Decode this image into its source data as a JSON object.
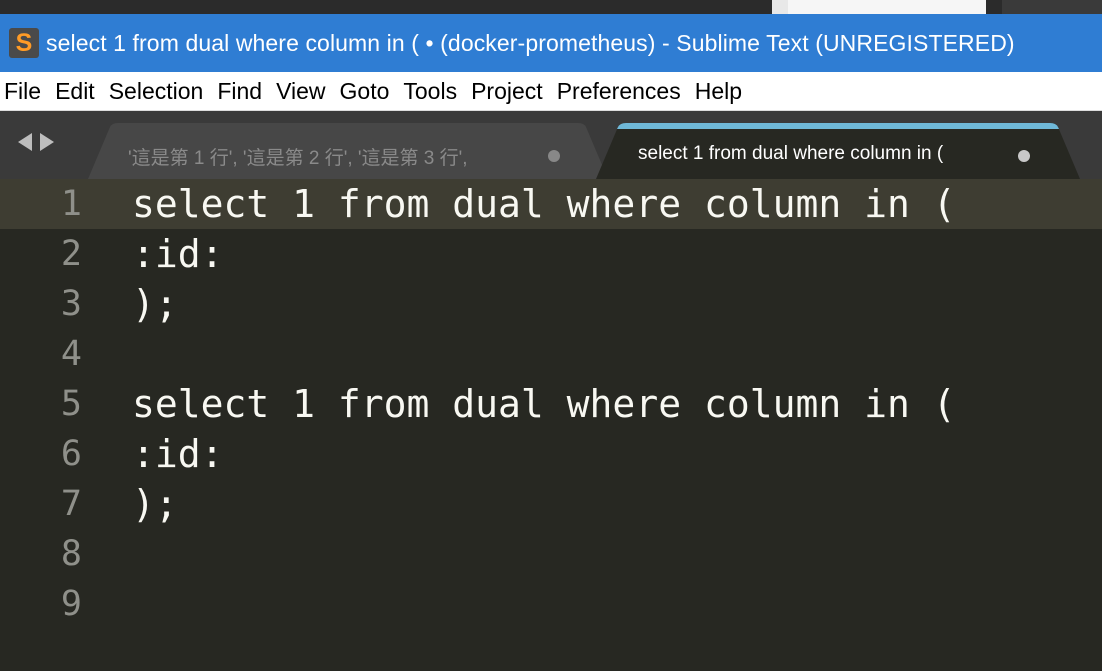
{
  "window": {
    "title": "select 1 from dual where column in ( • (docker-prometheus) - Sublime Text (UNREGISTERED)",
    "app_icon": "sublime-text-icon",
    "app_icon_glyph": "S",
    "title_bar_color": "#2f7dd3"
  },
  "menu": [
    {
      "label": "File"
    },
    {
      "label": "Edit"
    },
    {
      "label": "Selection"
    },
    {
      "label": "Find"
    },
    {
      "label": "View"
    },
    {
      "label": "Goto"
    },
    {
      "label": "Tools"
    },
    {
      "label": "Project"
    },
    {
      "label": "Preferences"
    },
    {
      "label": "Help"
    }
  ],
  "tabs": [
    {
      "label": "'這是第 1 行', '這是第 2 行', '這是第 3 行',",
      "active": false,
      "modified": true
    },
    {
      "label": "select 1 from dual where column in (",
      "active": true,
      "modified": true
    }
  ],
  "editor": {
    "current_line": 1,
    "lines": [
      {
        "number": "1",
        "text": "select 1 from dual where column in ("
      },
      {
        "number": "2",
        "text": ":id:"
      },
      {
        "number": "3",
        "text": ");"
      },
      {
        "number": "4",
        "text": ""
      },
      {
        "number": "5",
        "text": "select 1 from dual where column in ("
      },
      {
        "number": "6",
        "text": ":id:"
      },
      {
        "number": "7",
        "text": ");"
      },
      {
        "number": "8",
        "text": ""
      },
      {
        "number": "9",
        "text": ""
      }
    ],
    "background_color": "#272822",
    "text_color": "#f8f8f2",
    "gutter_color": "#8f908a",
    "active_tab_accent": "#6fb8d8"
  }
}
